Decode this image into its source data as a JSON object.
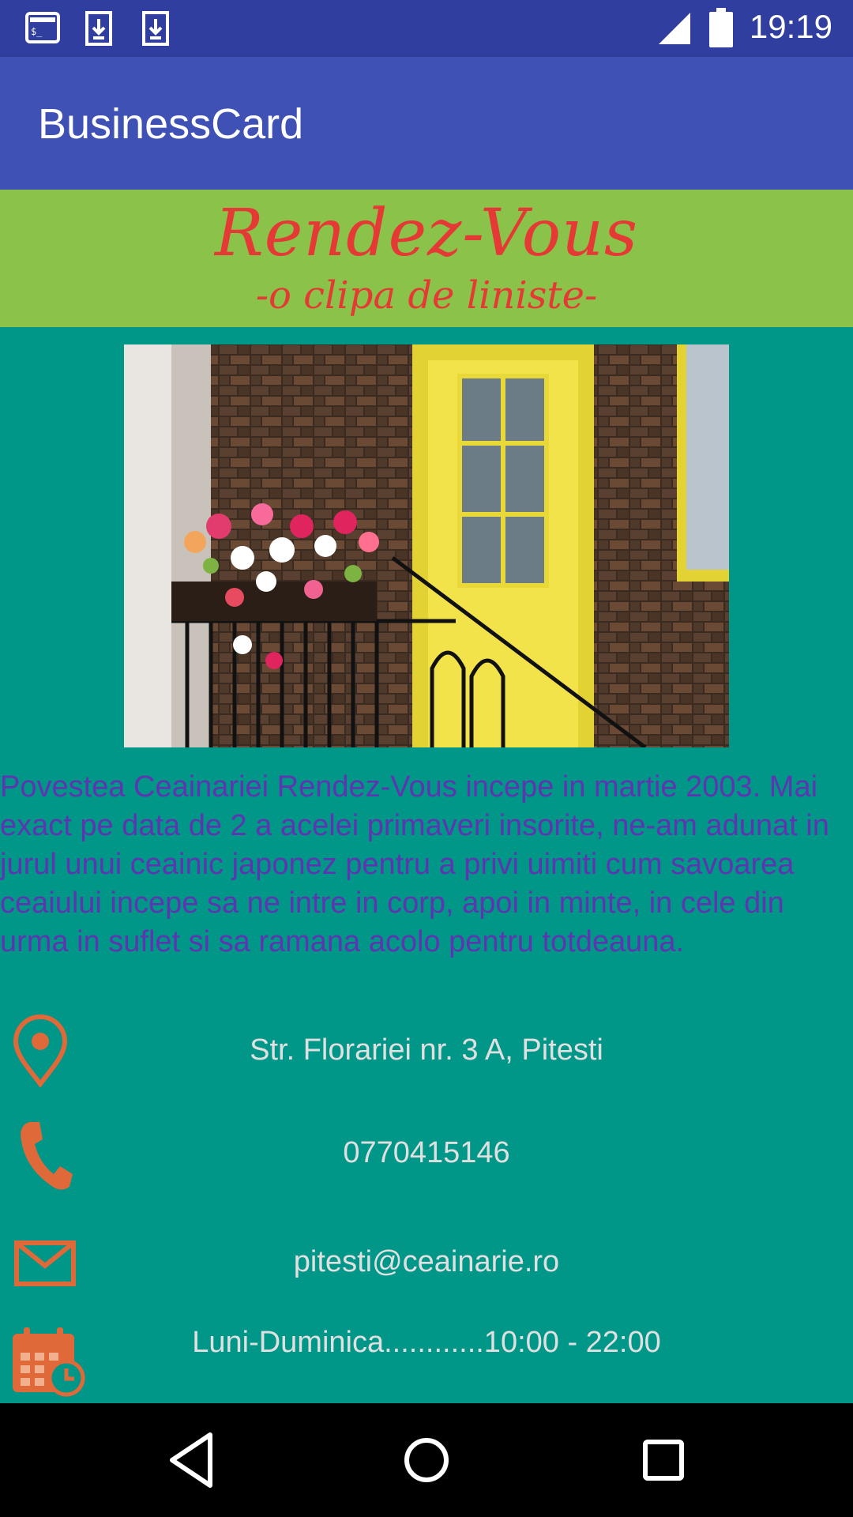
{
  "status_bar": {
    "time": "19:19",
    "left_icons": [
      "terminal-icon",
      "download-icon",
      "download-icon"
    ],
    "right_icons": [
      "signal-icon",
      "battery-icon"
    ]
  },
  "app_bar": {
    "title": "BusinessCard"
  },
  "banner": {
    "title": "Rendez-Vous",
    "subtitle": "-o clipa de liniste-",
    "background": "#8BC34A",
    "text_color": "#E53935"
  },
  "story": "Povestea Ceainariei Rendez-Vous incepe in martie 2003. Mai exact pe data de 2 a acelei primaveri insorite, ne-am adunat in jurul unui ceainic japonez pentru a privi uimiti cum savoarea ceaiului incepe sa ne intre in corp, apoi in minte, in cele din urma in suflet si sa ramana acolo pentru totdeauna.",
  "contacts": {
    "address": "Str. Florariei nr. 3 A, Pitesti",
    "phone": "0770415146",
    "email": "pitesti@ceainarie.ro",
    "hours": "Luni-Duminica............10:00 - 22:00"
  },
  "colors": {
    "status_bar": "#303F9F",
    "app_bar": "#3F51B5",
    "page_background": "#009688",
    "story_text": "#5E35B1",
    "icon_color": "#E0693A",
    "contact_text": "#E0E0E0"
  },
  "nav_bar": {
    "buttons": [
      "back-icon",
      "home-icon",
      "recents-icon"
    ]
  }
}
